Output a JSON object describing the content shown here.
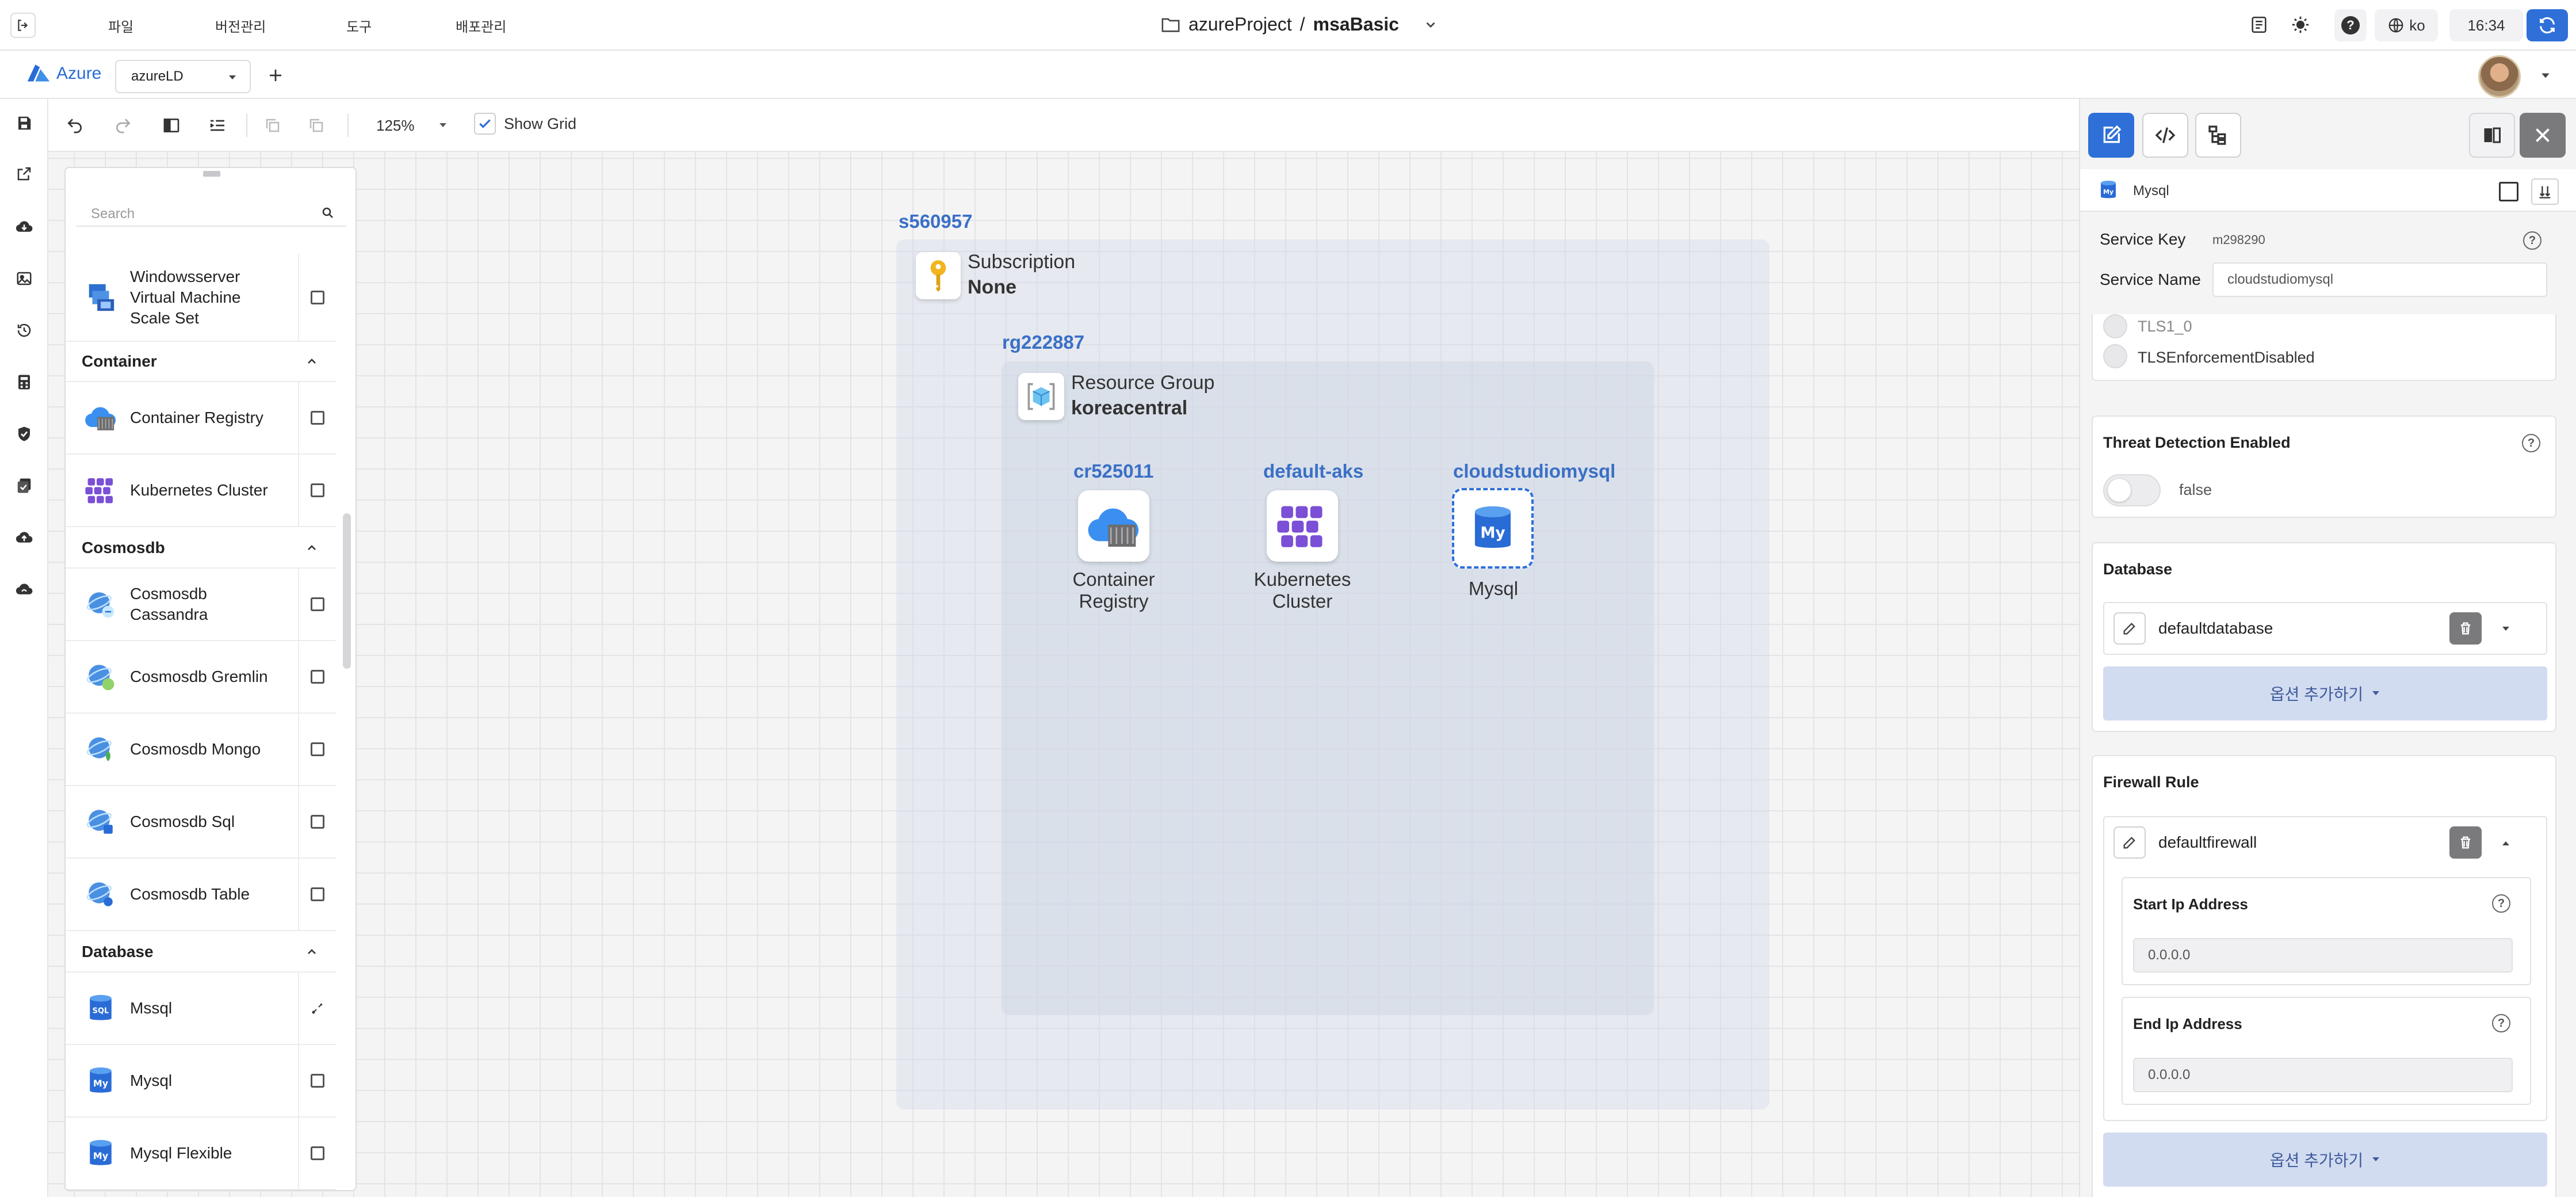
{
  "topbar": {
    "menus": [
      "파일",
      "버전관리",
      "도구",
      "배포관리"
    ],
    "project": "azureProject",
    "separator": "/",
    "model": "msaBasic",
    "language": "ko",
    "time": "16:34"
  },
  "tabs": {
    "brand": "Azure",
    "selector_value": "azureLD"
  },
  "toolbar": {
    "zoom": "125%",
    "show_grid_label": "Show Grid",
    "show_grid_checked": true
  },
  "palette": {
    "search_placeholder": "Search",
    "items_top": [
      {
        "label": "Windowsserver Virtual Machine Scale Set"
      }
    ],
    "categories": [
      {
        "name": "Container"
      },
      {
        "name": "Cosmosdb"
      },
      {
        "name": "Database"
      }
    ],
    "container_items": [
      {
        "label": "Container Registry"
      },
      {
        "label": "Kubernetes Cluster"
      }
    ],
    "cosmosdb_items": [
      {
        "label": "Cosmosdb Cassandra"
      },
      {
        "label": "Cosmosdb Gremlin"
      },
      {
        "label": "Cosmosdb Mongo"
      },
      {
        "label": "Cosmosdb Sql"
      },
      {
        "label": "Cosmosdb Table"
      }
    ],
    "database_items": [
      {
        "label": "Mssql"
      },
      {
        "label": "Mysql"
      },
      {
        "label": "Mysql Flexible"
      }
    ]
  },
  "diagram": {
    "subscription": {
      "id": "s560957",
      "type_label": "Subscription",
      "value": "None"
    },
    "resource_group": {
      "id": "rg222887",
      "type_label": "Resource Group",
      "value": "koreacentral"
    },
    "nodes": [
      {
        "id": "cr525011",
        "name_line1": "Container",
        "name_line2": "Registry"
      },
      {
        "id": "default-aks",
        "name_line1": "Kubernetes",
        "name_line2": "Cluster"
      },
      {
        "id": "cloudstudiomysql",
        "name_line1": "Mysql",
        "name_line2": ""
      }
    ]
  },
  "panel": {
    "header_title": "Mysql",
    "service_key_label": "Service Key",
    "service_key_value": "m298290",
    "service_name_label": "Service Name",
    "service_name_value": "cloudstudiomysql",
    "tls_options": [
      "TLS1_0",
      "TLSEnforcementDisabled"
    ],
    "threat_detection": {
      "label": "Threat Detection Enabled",
      "value": "false"
    },
    "database": {
      "title": "Database",
      "item": "defaultdatabase",
      "add_label": "옵션 추가하기"
    },
    "firewall": {
      "title": "Firewall Rule",
      "item": "defaultfirewall",
      "start_ip_label": "Start Ip Address",
      "start_ip_value": "0.0.0.0",
      "end_ip_label": "End Ip Address",
      "end_ip_value": "0.0.0.0",
      "add_label": "옵션 추가하기"
    }
  },
  "colors": {
    "accent": "#2f6fd8",
    "label_blue": "#3a6fc6",
    "add_button_bg": "#d2dcf0"
  }
}
